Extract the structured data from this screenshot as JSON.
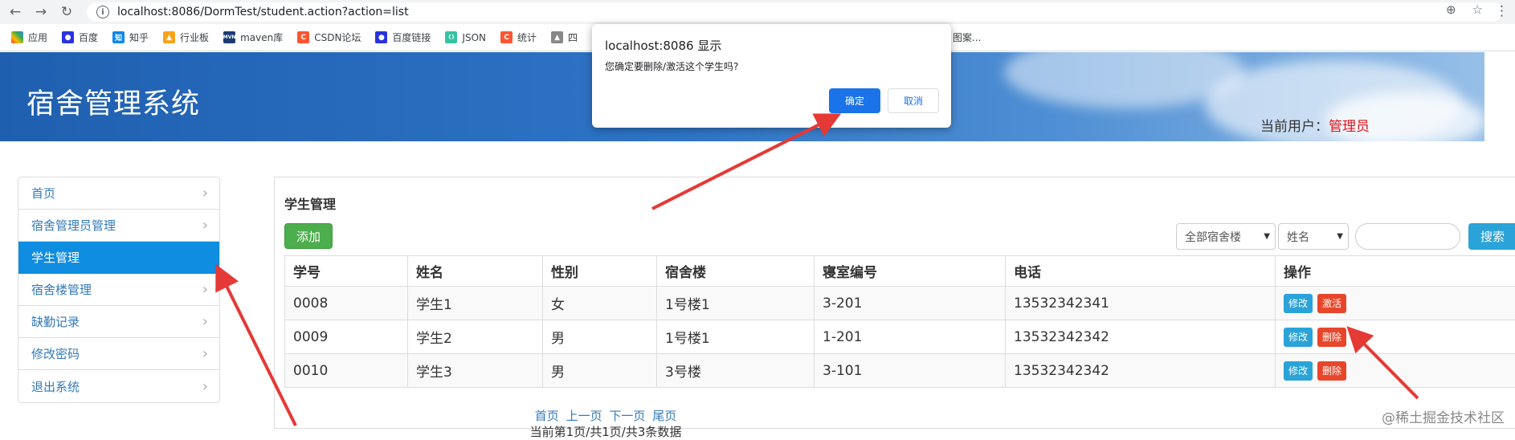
{
  "browser": {
    "url": "localhost:8086/DormTest/student.action?action=list",
    "bookmarks": [
      "应用",
      "百度",
      "知乎",
      "行业板",
      "maven库",
      "CSDN论坛",
      "百度链接",
      "JSON",
      "统计",
      "四",
      "图案..."
    ]
  },
  "header": {
    "title": "宿舍管理系统",
    "user_label": "当前用户：",
    "user_name": "管理员"
  },
  "sidebar": {
    "items": [
      {
        "label": "首页"
      },
      {
        "label": "宿舍管理员管理"
      },
      {
        "label": "学生管理"
      },
      {
        "label": "宿舍楼管理"
      },
      {
        "label": "缺勤记录"
      },
      {
        "label": "修改密码"
      },
      {
        "label": "退出系统"
      }
    ]
  },
  "main": {
    "title": "学生管理",
    "add_label": "添加",
    "building_select": "全部宿舍楼",
    "field_select": "姓名",
    "search_value": "",
    "search_label": "搜索",
    "columns": [
      "学号",
      "姓名",
      "性别",
      "宿舍楼",
      "寝室编号",
      "电话",
      "操作"
    ],
    "rows": [
      {
        "id": "0008",
        "name": "学生1",
        "gender": "女",
        "building": "1号楼1",
        "room": "3-201",
        "phone": "13532342341",
        "edit": "修改",
        "action": "激活"
      },
      {
        "id": "0009",
        "name": "学生2",
        "gender": "男",
        "building": "1号楼1",
        "room": "1-201",
        "phone": "13532342342",
        "edit": "修改",
        "action": "删除"
      },
      {
        "id": "0010",
        "name": "学生3",
        "gender": "男",
        "building": "3号楼",
        "room": "3-101",
        "phone": "13532342342",
        "edit": "修改",
        "action": "删除"
      }
    ],
    "pager": {
      "first": "首页",
      "prev": "上一页",
      "next": "下一页",
      "last": "尾页"
    },
    "pager_info": "当前第1页/共1页/共3条数据"
  },
  "dialog": {
    "title": "localhost:8086 显示",
    "message": "您确定要删除/激活这个学生吗?",
    "ok": "确定",
    "cancel": "取消"
  },
  "watermark": "@稀土掘金技术社区",
  "colors": {
    "accent": "#0f8de0",
    "danger": "#e8462b",
    "success": "#4cae4c",
    "info": "#2aa3d9",
    "annotation": "#e53935"
  }
}
